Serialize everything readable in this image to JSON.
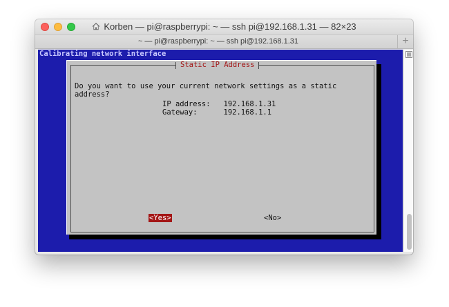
{
  "window": {
    "title": "Korben — pi@raspberrypi: ~ — ssh pi@192.168.1.31 — 82×23",
    "tab_label": "~ — pi@raspberrypi: ~ — ssh pi@192.168.1.31",
    "add_tab_label": "+"
  },
  "terminal": {
    "header_line": "Calibrating network interface",
    "background_color": "#1c1cac"
  },
  "dialog": {
    "title": "Static IP Address",
    "question_line1": "Do you want to use your current network settings as a static",
    "question_line2": "address?",
    "ip_row": "IP address:   192.168.1.31",
    "gateway_row": "Gateway:      192.168.1.1",
    "yes_label": "<Yes>",
    "no_label": "<No>",
    "accent_color": "#a31616"
  }
}
